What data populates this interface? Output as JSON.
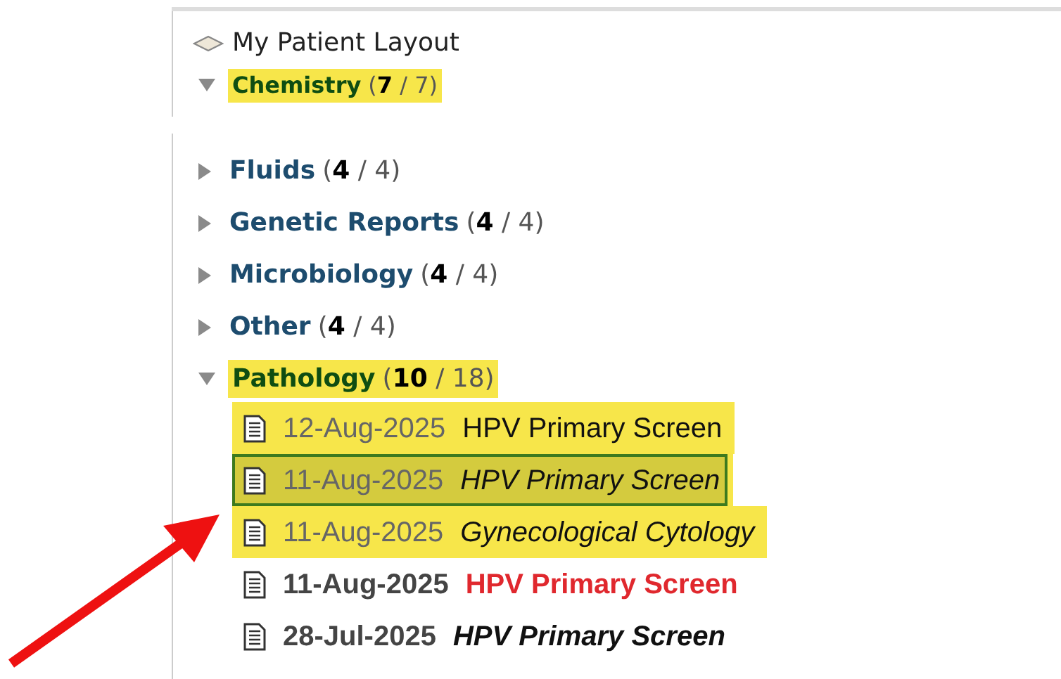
{
  "top_section": {
    "title": "My Patient Layout",
    "categories": [
      {
        "name": "Chemistry",
        "count_text": "(**7** / 7)",
        "expanded": true,
        "highlighted": true
      }
    ]
  },
  "tree": {
    "categories": [
      {
        "name": "Fluids",
        "count_text": "(**4** / 4)",
        "expanded": false,
        "highlighted": false
      },
      {
        "name": "Genetic Reports",
        "count_text": "(**4** / 4)",
        "expanded": false,
        "highlighted": false
      },
      {
        "name": "Microbiology",
        "count_text": "(**4** / 4)",
        "expanded": false,
        "highlighted": false
      },
      {
        "name": "Other",
        "count_text": "(**4** / 4)",
        "expanded": false,
        "highlighted": false
      },
      {
        "name": "Pathology",
        "count_text": "(**10** / 18)",
        "expanded": true,
        "highlighted": true,
        "documents": [
          {
            "date": "12-Aug-2025",
            "title": "HPV Primary Screen",
            "unread": false,
            "italic": false,
            "abnormal": false,
            "highlighted": true,
            "selected": false
          },
          {
            "date": "11-Aug-2025",
            "title": "HPV Primary Screen",
            "unread": false,
            "italic": true,
            "abnormal": false,
            "highlighted": true,
            "selected": true
          },
          {
            "date": "11-Aug-2025",
            "title": "Gynecological Cytology",
            "unread": false,
            "italic": true,
            "abnormal": false,
            "highlighted": true,
            "selected": false
          },
          {
            "date": "11-Aug-2025",
            "title": "HPV Primary Screen",
            "unread": true,
            "italic": false,
            "abnormal": true,
            "highlighted": false,
            "selected": false
          },
          {
            "date": "28-Jul-2025",
            "title": "HPV Primary Screen",
            "unread": true,
            "italic": true,
            "abnormal": false,
            "highlighted": false,
            "selected": false
          }
        ]
      }
    ]
  }
}
